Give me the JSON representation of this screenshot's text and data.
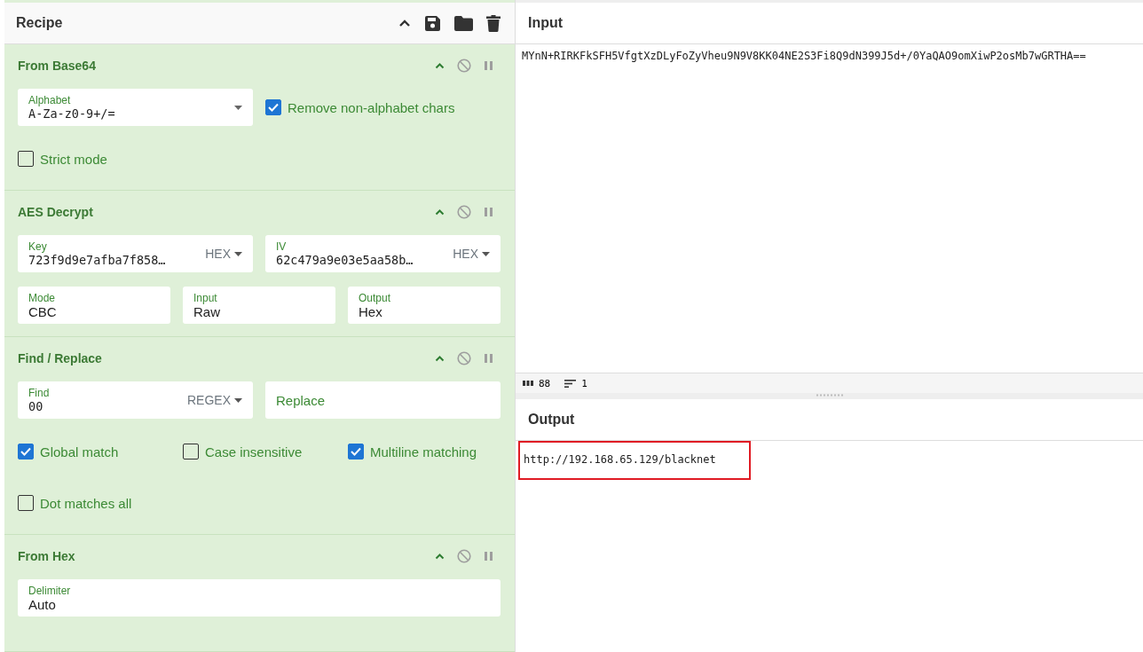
{
  "recipe": {
    "title": "Recipe",
    "operations": [
      {
        "name": "From Base64",
        "rows": [
          {
            "args": [
              {
                "kind": "code-field",
                "label": "Alphabet",
                "value": "A-Za-z0-9+/=",
                "dropdown": true
              },
              {
                "kind": "checkbox",
                "label": "Remove non-alphabet chars",
                "checked": true
              }
            ]
          },
          {
            "args": [
              {
                "kind": "checkbox",
                "label": "Strict mode",
                "checked": false
              }
            ]
          }
        ]
      },
      {
        "name": "AES Decrypt",
        "rows": [
          {
            "args": [
              {
                "kind": "code-field",
                "label": "Key",
                "value": "723f9d9e7afba7f858…",
                "toggle": "HEX"
              },
              {
                "kind": "code-field",
                "label": "IV",
                "value": "62c479a9e03e5aa58b…",
                "toggle": "HEX"
              }
            ]
          },
          {
            "args": [
              {
                "kind": "text-field",
                "label": "Mode",
                "value": "CBC"
              },
              {
                "kind": "text-field",
                "label": "Input",
                "value": "Raw"
              },
              {
                "kind": "text-field",
                "label": "Output",
                "value": "Hex"
              }
            ]
          }
        ]
      },
      {
        "name": "Find / Replace",
        "rows": [
          {
            "args": [
              {
                "kind": "code-field",
                "label": "Find",
                "value": "00",
                "toggle": "REGEX"
              },
              {
                "kind": "empty-field",
                "placeholder": "Replace"
              }
            ]
          },
          {
            "args": [
              {
                "kind": "checkbox",
                "label": "Global match",
                "checked": true
              },
              {
                "kind": "checkbox",
                "label": "Case insensitive",
                "checked": false
              },
              {
                "kind": "checkbox",
                "label": "Multiline matching",
                "checked": true
              }
            ]
          },
          {
            "args": [
              {
                "kind": "checkbox",
                "label": "Dot matches all",
                "checked": false
              }
            ]
          }
        ]
      },
      {
        "name": "From Hex",
        "rows": [
          {
            "args": [
              {
                "kind": "text-field",
                "label": "Delimiter",
                "value": "Auto"
              }
            ]
          }
        ]
      }
    ]
  },
  "input": {
    "title": "Input",
    "text": "MYnN+RIRKFkSFH5VfgtXzDLyFoZyVheu9N9V8KK04NE2S3Fi8Q9dN399J5d+/0YaQAO9omXiwP2osMb7wGRTHA==",
    "length": "88",
    "lines": "1"
  },
  "output": {
    "title": "Output",
    "text": "http://192.168.65.129/blacknet",
    "highlighted": true
  }
}
